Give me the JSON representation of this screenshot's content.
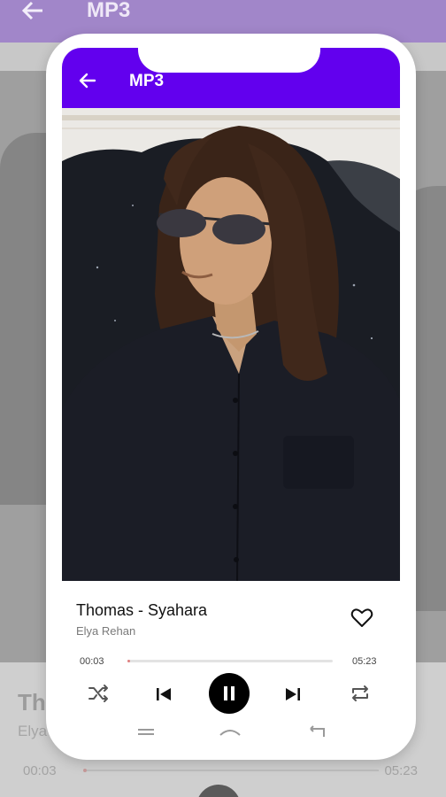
{
  "background_app": {
    "title": "MP3",
    "song_title": "Th",
    "artist": "Elya",
    "time_current": "00:03",
    "time_total": "05:23"
  },
  "header": {
    "title": "MP3",
    "back_icon": "arrow-back-icon",
    "color": "#6200ee"
  },
  "player": {
    "song_title": "Thomas - Syahara",
    "artist": "Elya Rehan",
    "time_current": "00:03",
    "time_total": "05:23",
    "progress_fraction": 0.01,
    "favorite_icon": "heart-outline-icon",
    "controls": [
      "shuffle-icon",
      "skip-previous-icon",
      "pause-icon",
      "skip-next-icon",
      "repeat-icon"
    ],
    "accent": "#e08080"
  },
  "system_nav": [
    "menu-icon",
    "home-icon",
    "back-icon"
  ]
}
